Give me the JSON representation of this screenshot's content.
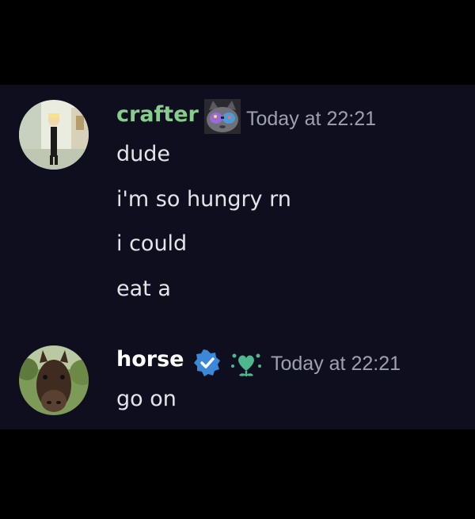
{
  "colors": {
    "background": "#0f0e1e",
    "text": "#e4e5ea",
    "timestamp": "#9ea1ad",
    "verified": "#3b88d8",
    "heart_badge": "#4db88e"
  },
  "messages": [
    {
      "author": "crafter",
      "author_color": "#86cf8b",
      "avatar": "avatar-crafter",
      "decoration": "cat-with-sunglasses-icon",
      "timestamp": "Today at 22:21",
      "lines": [
        "dude",
        "i'm so hungry rn",
        "i could",
        "eat a"
      ]
    },
    {
      "author": "horse",
      "author_color": "#ffffff",
      "avatar": "avatar-horse",
      "badges": [
        "verified-check-icon",
        "heart-flower-icon"
      ],
      "timestamp": "Today at 22:21",
      "lines": [
        "go on"
      ]
    }
  ]
}
